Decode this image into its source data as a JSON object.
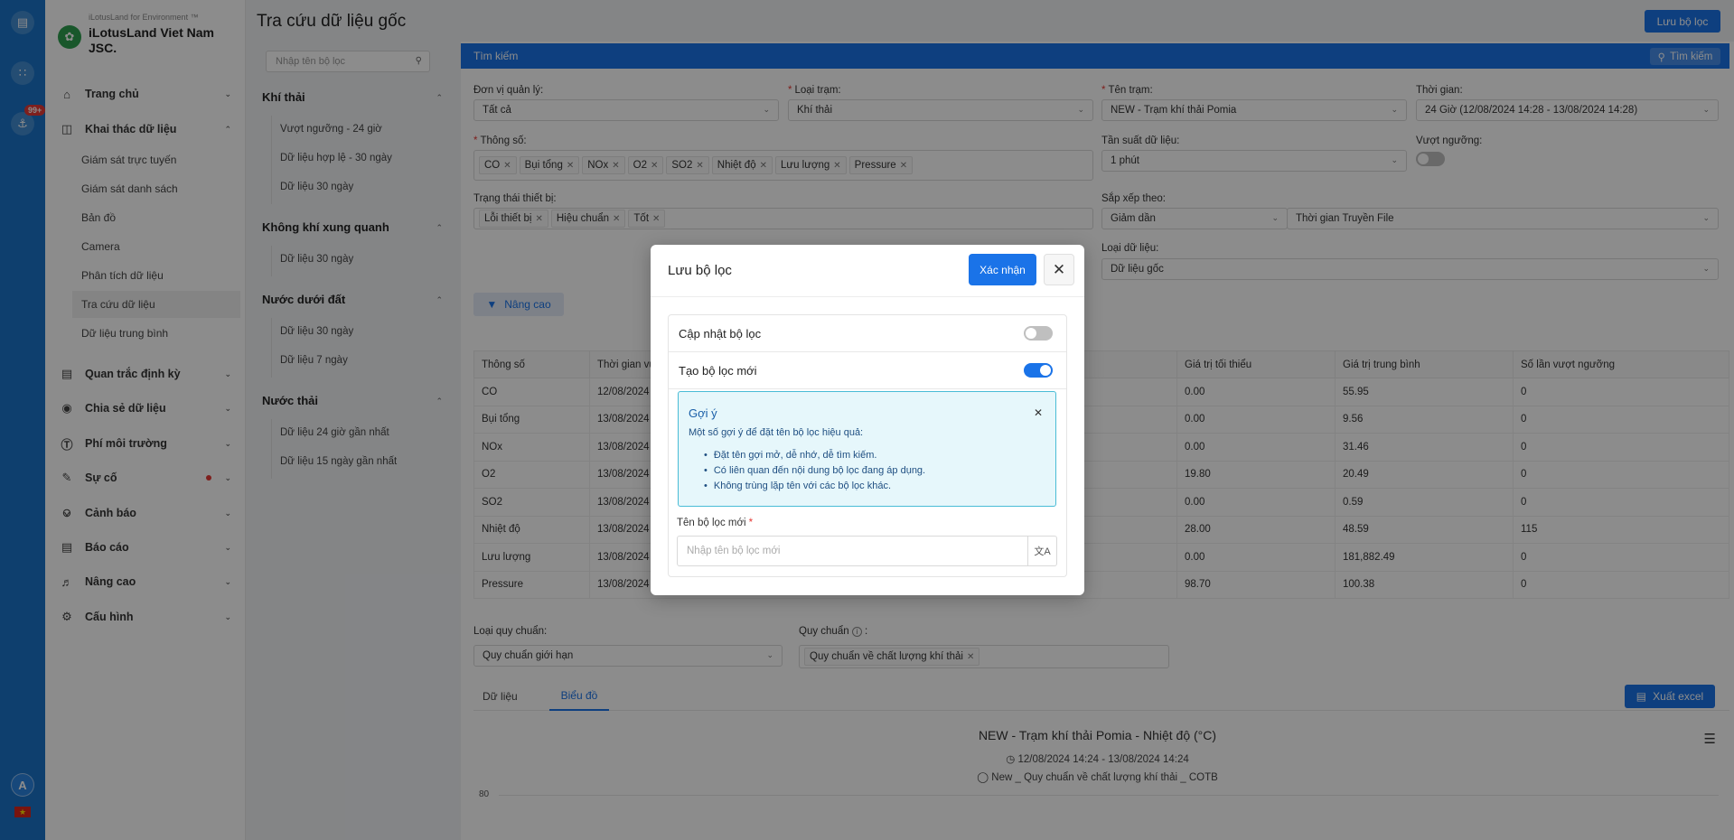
{
  "rail": {
    "badge": "99+",
    "avatar": "A"
  },
  "brand": {
    "tag": "iLotusLand for Environment ™",
    "name": "iLotusLand Viet Nam JSC."
  },
  "nav": {
    "items": [
      {
        "label": "Trang chủ",
        "icon": "home-icon"
      },
      {
        "label": "Khai thác dữ liệu",
        "icon": "monitor-icon"
      },
      {
        "label": "Quan trắc định kỳ",
        "icon": "clipboard-icon"
      },
      {
        "label": "Chia sẻ dữ liệu",
        "icon": "share-icon"
      },
      {
        "label": "Phí môi trường",
        "icon": "dollar-icon"
      },
      {
        "label": "Sự cố",
        "icon": "edit-icon"
      },
      {
        "label": "Cảnh báo",
        "icon": "bell-icon"
      },
      {
        "label": "Báo cáo",
        "icon": "report-icon"
      },
      {
        "label": "Nâng cao",
        "icon": "megaphone-icon"
      },
      {
        "label": "Cấu hình",
        "icon": "settings-icon"
      }
    ],
    "sub_items": [
      "Giám sát trực tuyến",
      "Giám sát danh sách",
      "Bản đồ",
      "Camera",
      "Phân tích dữ liệu",
      "Tra cứu dữ liệu",
      "Dữ liệu trung bình"
    ]
  },
  "header": {
    "title": "Tra cứu dữ liệu gốc",
    "save_filter": "Lưu bộ lọc"
  },
  "filter_list": {
    "search_placeholder": "Nhập tên bộ lọc",
    "groups": [
      {
        "name": "Khí thải",
        "items": [
          "Vượt ngưỡng - 24 giờ",
          "Dữ liệu hợp lệ - 30 ngày",
          "Dữ liệu 30 ngày"
        ]
      },
      {
        "name": "Không khí xung quanh",
        "items": [
          "Dữ liệu 30 ngày"
        ]
      },
      {
        "name": "Nước dưới đất",
        "items": [
          "Dữ liệu 30 ngày",
          "Dữ liệu 7 ngày"
        ]
      },
      {
        "name": "Nước thải",
        "items": [
          "Dữ liệu 24 giờ gần nhất",
          "Dữ liệu 15 ngày gần nhất"
        ]
      }
    ]
  },
  "search": {
    "bar_title": "Tìm kiếm",
    "bar_button": "Tìm kiếm",
    "unit_label": "Đơn vị quản lý:",
    "unit_value": "Tất cả",
    "station_type_label": "Loại trạm:",
    "station_type_value": "Khí thải",
    "station_label": "Tên trạm:",
    "station_value": "NEW - Trạm khí thải Pomia",
    "time_label": "Thời gian:",
    "time_value": "24 Giờ (12/08/2024 14:28 - 13/08/2024 14:28)",
    "params_label": "Thông số:",
    "params": [
      "CO",
      "Bụi tổng",
      "NOx",
      "O2",
      "SO2",
      "Nhiệt độ",
      "Lưu lượng",
      "Pressure"
    ],
    "freq_label": "Tần suất dữ liệu:",
    "freq_value": "1 phút",
    "exceed_label": "Vượt ngưỡng:",
    "device_label": "Trạng thái thiết bị:",
    "device_tags": [
      "Lỗi thiết bị",
      "Hiệu chuẩn",
      "Tốt"
    ],
    "sort_label": "Sắp xếp theo:",
    "sort_order": "Giảm dần",
    "sort_field": "Thời gian Truyền File",
    "data_type_label": "Loại dữ liệu:",
    "data_type_value": "Dữ liệu gốc",
    "advanced": "Nâng cao"
  },
  "table": {
    "headers": [
      "Thông số",
      "Thời gian vư",
      "Giá trị tối thiểu",
      "Giá trị trung bình",
      "Số lần vượt ngưỡng"
    ],
    "rows": [
      [
        "CO",
        "12/08/2024",
        "0.00",
        "55.95",
        "0"
      ],
      [
        "Bụi tổng",
        "13/08/2024",
        "0.00",
        "9.56",
        "0"
      ],
      [
        "NOx",
        "13/08/2024",
        "0.00",
        "31.46",
        "0"
      ],
      [
        "O2",
        "13/08/2024",
        "19.80",
        "20.49",
        "0"
      ],
      [
        "SO2",
        "13/08/2024",
        "0.00",
        "0.59",
        "0"
      ],
      [
        "Nhiệt độ",
        "13/08/2024",
        "28.00",
        "48.59",
        "115"
      ],
      [
        "Lưu lượng",
        "13/08/2024",
        "0.00",
        "181,882.49",
        "0"
      ],
      [
        "Pressure",
        "13/08/2024",
        "98.70",
        "100.38",
        "0"
      ]
    ]
  },
  "standard": {
    "type_label": "Loại quy chuẩn:",
    "type_value": "Quy chuẩn giới hạn",
    "label": "Quy chuẩn",
    "tag": "Quy chuẩn về chất lượng khí thải"
  },
  "tabs": {
    "data": "Dữ liệu",
    "chart": "Biểu đồ",
    "export": "Xuất excel"
  },
  "chart": {
    "title": "NEW - Trạm khí thải Pomia - Nhiệt độ (°C)",
    "range": "12/08/2024 14:24 - 13/08/2024 14:24",
    "standard": "New _ Quy chuẩn về chất lượng khí thải _ COTB",
    "y_tick": "80"
  },
  "modal": {
    "title": "Lưu bộ lọc",
    "confirm": "Xác nhận",
    "update_label": "Cập nhật bộ lọc",
    "create_label": "Tạo bộ lọc mới",
    "hint_title": "Gợi ý",
    "hint_intro": "Một số gợi ý để đặt tên bộ lọc hiệu quả:",
    "hint_items": [
      "Đặt tên gợi mở, dễ nhớ, dễ tìm kiếm.",
      "Có liên quan đến nội dung bộ lọc đang áp dụng.",
      "Không trùng lặp tên với các bộ lọc khác."
    ],
    "name_label": "Tên bộ lọc mới",
    "name_placeholder": "Nhập tên bộ lọc mới"
  },
  "colors": {
    "primary": "#1a73e8",
    "rail": "#1a73c8",
    "hint_bg": "#e6f7fb",
    "danger": "#e53935"
  }
}
